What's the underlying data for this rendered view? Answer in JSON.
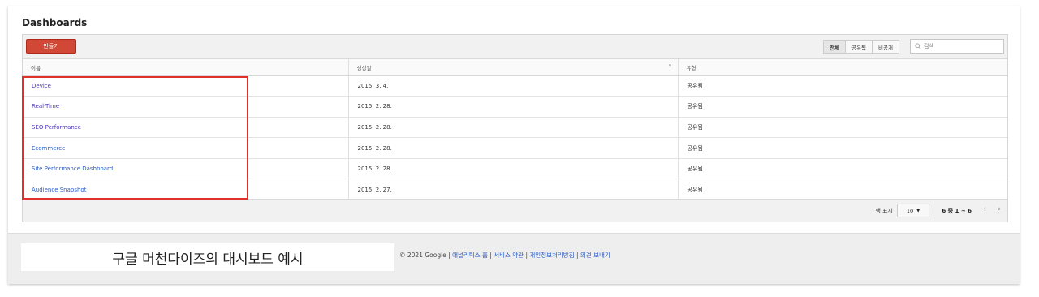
{
  "page": {
    "title": "Dashboards"
  },
  "toolbar": {
    "create_label": "만들기",
    "filters": [
      "전체",
      "공유됨",
      "비공개"
    ],
    "search_placeholder": "검색"
  },
  "table": {
    "columns": [
      "이름",
      "생성일",
      "유형"
    ],
    "sort_indicator": "↑",
    "rows": [
      {
        "name": "Device",
        "date": "2015. 3. 4.",
        "type": "공유됨"
      },
      {
        "name": "Real-Time",
        "date": "2015. 2. 28.",
        "type": "공유됨"
      },
      {
        "name": "SEO Performance",
        "date": "2015. 2. 28.",
        "type": "공유됨"
      },
      {
        "name": "Ecommerce",
        "date": "2015. 2. 28.",
        "type": "공유됨"
      },
      {
        "name": "Site Performance Dashboard",
        "date": "2015. 2. 28.",
        "type": "공유됨"
      },
      {
        "name": "Audience Snapshot",
        "date": "2015. 2. 27.",
        "type": "공유됨"
      }
    ]
  },
  "pagination": {
    "rows_label": "행 표시",
    "rows_value": "10",
    "range": "6 중 1 ~ 6",
    "prev": "‹",
    "next": "›"
  },
  "caption": "구글 머천다이즈의 대시보드 예시",
  "footer": {
    "copyright": "© 2021 Google | ",
    "links": [
      "애널리틱스 홈",
      "서비스 약관",
      "개인정보처리방침",
      "의견 보내기"
    ],
    "separator": " | "
  },
  "colors": {
    "accent": "#d14836",
    "highlight": "#e0302a",
    "link": "#4b34b8"
  }
}
